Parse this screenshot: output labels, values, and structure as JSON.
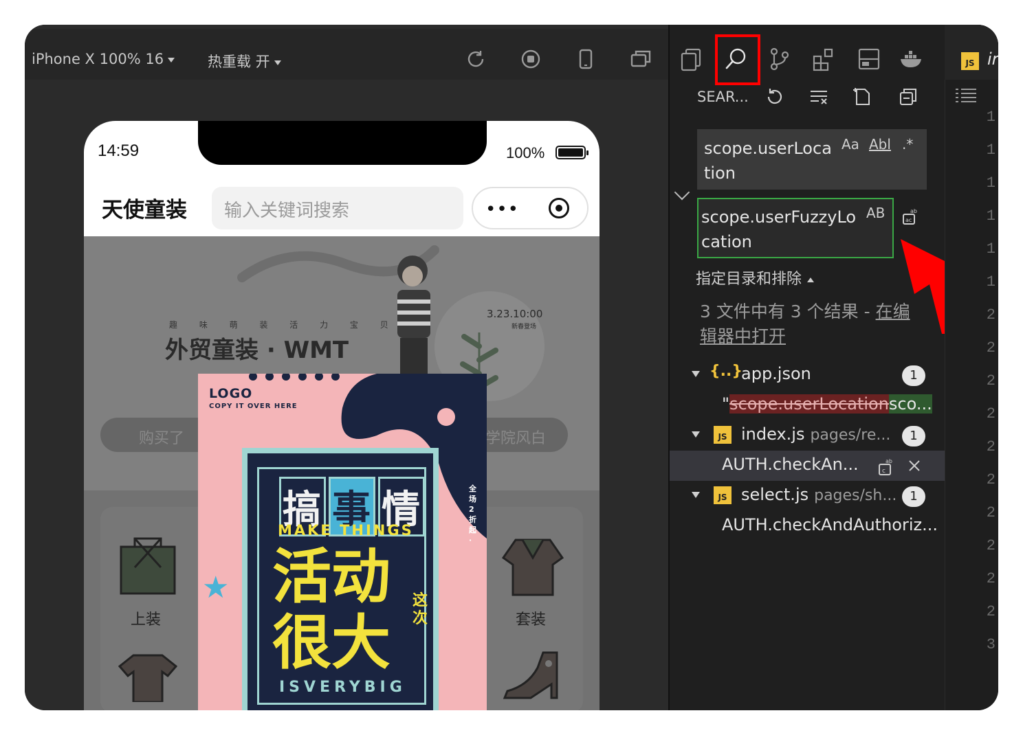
{
  "toolbar": {
    "device": "iPhone X 100% 16",
    "hot_reload": "热重载 开",
    "icons": [
      "refresh-icon",
      "stop-icon",
      "phone-icon",
      "window-icon"
    ]
  },
  "phone": {
    "time": "14:59",
    "battery": "100%",
    "app_title": "天使童装",
    "search_placeholder": "输入关键词搜索",
    "capsule_dots": "•••"
  },
  "banner": {
    "subtitle": "趣 味 萌 装   活 力 宝 贝",
    "title": "外贸童装 · WMT",
    "date": "3.23.10:00",
    "date_sub": "新春登场"
  },
  "notice": {
    "left": "购买了",
    "right": "学院风白"
  },
  "categories": [
    {
      "label": "上装"
    },
    {
      "label": "套装"
    }
  ],
  "ad": {
    "logo": "LOGO",
    "copy": "COPY IT OVER HERE",
    "big_chars": [
      "搞",
      "事",
      "情"
    ],
    "make_things": "MAKE THINGS",
    "huge": "活动很大",
    "side": "这次",
    "isverybig": "ISVERYBIG",
    "vertical": "全场2折起·"
  },
  "search_panel": {
    "label": "SEAR...",
    "find_value": "scope.userLocation",
    "opt_case": "Aa",
    "opt_word": "Abl",
    "opt_regex": ".*",
    "replace_value": "scope.userFuzzyLocation",
    "opt_preserve": "AB",
    "files_toggle": "指定目录和排除",
    "summary_prefix": "3 文件中有 3 个结果 - ",
    "summary_link": "在编辑器中打开"
  },
  "results": [
    {
      "badge": "{..}",
      "file": "app.json",
      "path": "",
      "count": "1",
      "match_del": "scope.userLocation",
      "match_ins": "sco...",
      "match_prefix": "\""
    },
    {
      "badge": "JS",
      "file": "index.js",
      "path": "pages/re...",
      "count": "1",
      "match": "AUTH.checkAn..."
    },
    {
      "badge": "JS",
      "file": "select.js",
      "path": "pages/sh...",
      "count": "1",
      "match": "AUTH.checkAndAuthoriz..."
    }
  ],
  "editor": {
    "tab_badge": "JS",
    "tab_name": "ir",
    "gutter": [
      "1",
      "1",
      "1",
      "1",
      "1",
      "1",
      "2",
      "2",
      "2",
      "2",
      "2",
      "2",
      "2",
      "2",
      "2",
      "2",
      "3"
    ]
  },
  "colors": {
    "highlight": "#ff0000",
    "arrow": "#ff0000",
    "replace_border": "#3aa845",
    "js_yellow": "#f0c23b"
  }
}
